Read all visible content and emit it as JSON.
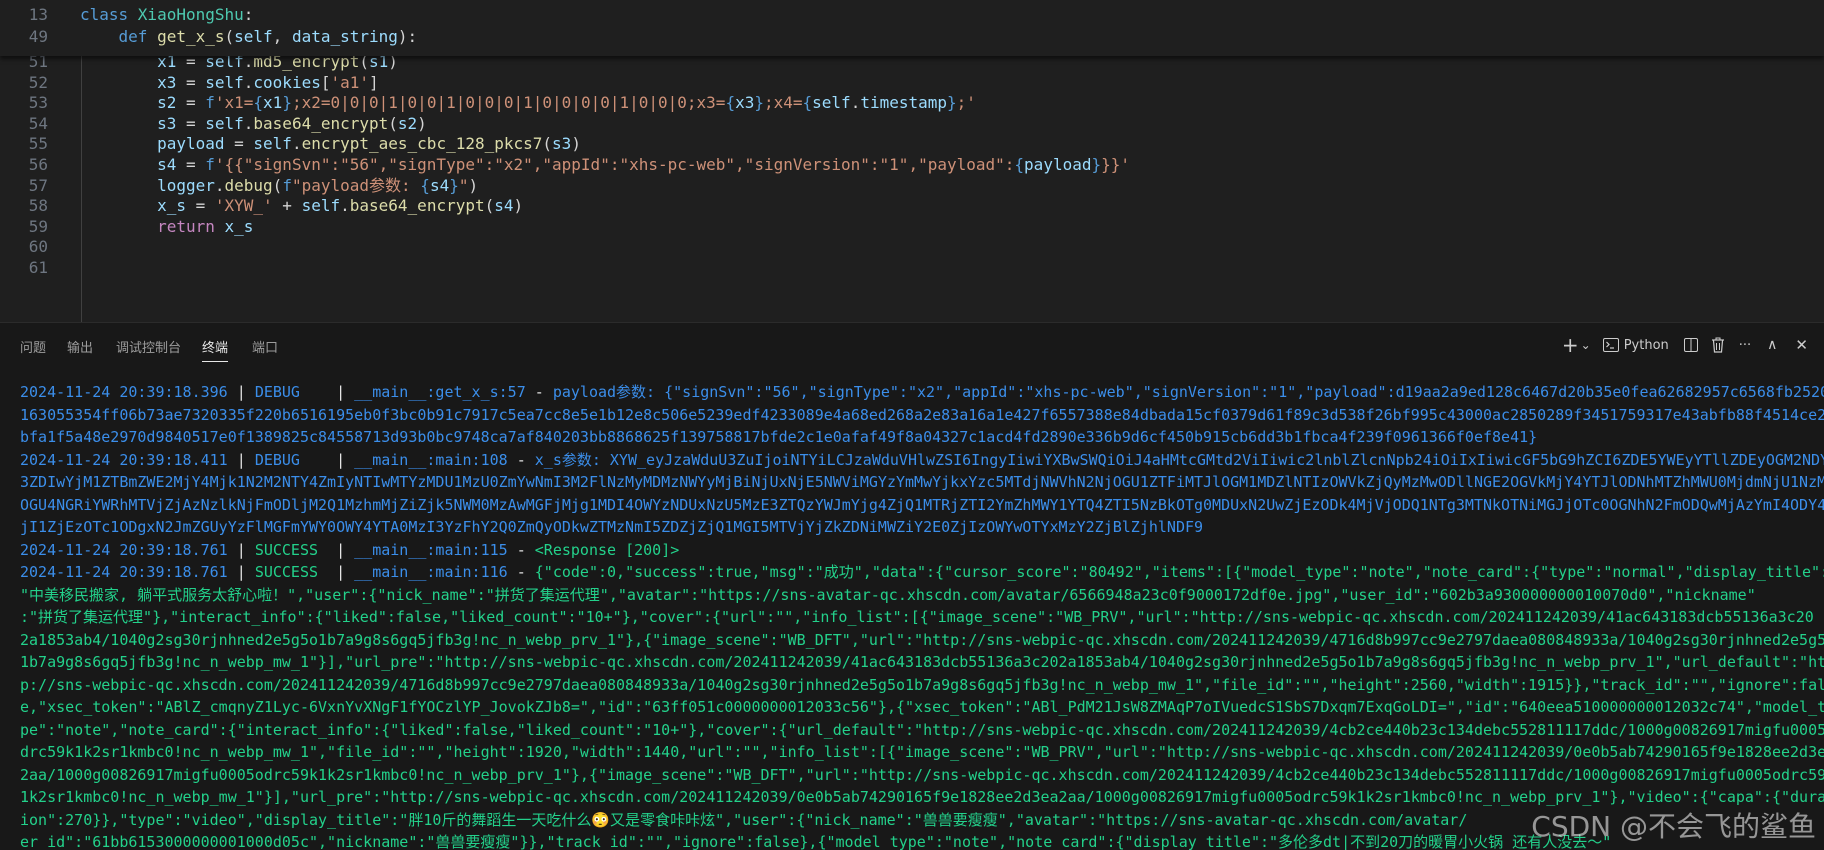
{
  "editor": {
    "sticky": [
      {
        "num": "13",
        "parts": [
          [
            "kw",
            "class "
          ],
          [
            "cls",
            "XiaoHongShu"
          ],
          [
            "tx",
            ":"
          ]
        ]
      },
      {
        "num": "49",
        "parts": [
          [
            "tx",
            "    "
          ],
          [
            "kw",
            "def "
          ],
          [
            "fn",
            "get_x_s"
          ],
          [
            "tx",
            "("
          ],
          [
            "var",
            "self"
          ],
          [
            "tx",
            ", "
          ],
          [
            "var",
            "data_string"
          ],
          [
            "tx",
            "):"
          ]
        ]
      }
    ],
    "lines": [
      {
        "num": "51",
        "parts": [
          [
            "tx",
            "        "
          ],
          [
            "var",
            "x1"
          ],
          [
            "tx",
            " = "
          ],
          [
            "var",
            "self"
          ],
          [
            "tx",
            "."
          ],
          [
            "fn",
            "md5_encrypt"
          ],
          [
            "tx",
            "("
          ],
          [
            "var",
            "s1"
          ],
          [
            "tx",
            ")"
          ]
        ]
      },
      {
        "num": "52",
        "parts": [
          [
            "tx",
            "        "
          ],
          [
            "var",
            "x3"
          ],
          [
            "tx",
            " = "
          ],
          [
            "var",
            "self"
          ],
          [
            "tx",
            "."
          ],
          [
            "var",
            "cookies"
          ],
          [
            "tx",
            "["
          ],
          [
            "str",
            "'a1'"
          ],
          [
            "tx",
            "]"
          ]
        ]
      },
      {
        "num": "53",
        "parts": [
          [
            "tx",
            "        "
          ],
          [
            "var",
            "s2"
          ],
          [
            "tx",
            " = "
          ],
          [
            "kw",
            "f"
          ],
          [
            "str",
            "'x1="
          ],
          [
            "brc",
            "{"
          ],
          [
            "var",
            "x1"
          ],
          [
            "brc",
            "}"
          ],
          [
            "str",
            ";x2=0|0|0|1|0|0|1|0|0|0|1|0|0|0|0|1|0|0|0;x3="
          ],
          [
            "brc",
            "{"
          ],
          [
            "var",
            "x3"
          ],
          [
            "brc",
            "}"
          ],
          [
            "str",
            ";x4="
          ],
          [
            "brc",
            "{"
          ],
          [
            "var",
            "self"
          ],
          [
            "tx",
            "."
          ],
          [
            "var",
            "timestamp"
          ],
          [
            "brc",
            "}"
          ],
          [
            "str",
            ";'"
          ]
        ]
      },
      {
        "num": "54",
        "parts": [
          [
            "tx",
            "        "
          ],
          [
            "var",
            "s3"
          ],
          [
            "tx",
            " = "
          ],
          [
            "var",
            "self"
          ],
          [
            "tx",
            "."
          ],
          [
            "fn",
            "base64_encrypt"
          ],
          [
            "tx",
            "("
          ],
          [
            "var",
            "s2"
          ],
          [
            "tx",
            ")"
          ]
        ]
      },
      {
        "num": "55",
        "parts": [
          [
            "tx",
            "        "
          ],
          [
            "var",
            "payload"
          ],
          [
            "tx",
            " = "
          ],
          [
            "var",
            "self"
          ],
          [
            "tx",
            "."
          ],
          [
            "fn",
            "encrypt_aes_cbc_128_pkcs7"
          ],
          [
            "tx",
            "("
          ],
          [
            "var",
            "s3"
          ],
          [
            "tx",
            ")"
          ]
        ]
      },
      {
        "num": "56",
        "parts": [
          [
            "tx",
            "        "
          ],
          [
            "var",
            "s4"
          ],
          [
            "tx",
            " = "
          ],
          [
            "kw",
            "f"
          ],
          [
            "str",
            "'{{\"signSvn\":\"56\",\"signType\":\"x2\",\"appId\":\"xhs-pc-web\",\"signVersion\":\"1\",\"payload\":"
          ],
          [
            "brc",
            "{"
          ],
          [
            "var",
            "payload"
          ],
          [
            "brc",
            "}"
          ],
          [
            "str",
            "}}'"
          ]
        ]
      },
      {
        "num": "57",
        "parts": [
          [
            "tx",
            "        "
          ],
          [
            "var",
            "logger"
          ],
          [
            "tx",
            "."
          ],
          [
            "fn",
            "debug"
          ],
          [
            "tx",
            "("
          ],
          [
            "kw",
            "f"
          ],
          [
            "str",
            "\"payload参数: "
          ],
          [
            "brc",
            "{"
          ],
          [
            "var",
            "s4"
          ],
          [
            "brc",
            "}"
          ],
          [
            "str",
            "\""
          ],
          [
            "tx",
            ")"
          ]
        ]
      },
      {
        "num": "58",
        "parts": [
          [
            "tx",
            "        "
          ],
          [
            "var",
            "x_s"
          ],
          [
            "tx",
            " = "
          ],
          [
            "str",
            "'XYW_'"
          ],
          [
            "tx",
            " + "
          ],
          [
            "var",
            "self"
          ],
          [
            "tx",
            "."
          ],
          [
            "fn",
            "base64_encrypt"
          ],
          [
            "tx",
            "("
          ],
          [
            "var",
            "s4"
          ],
          [
            "tx",
            ")"
          ]
        ]
      },
      {
        "num": "59",
        "parts": [
          [
            "tx",
            "        "
          ],
          [
            "ctl",
            "return "
          ],
          [
            "var",
            "x_s"
          ]
        ]
      },
      {
        "num": "60",
        "parts": []
      },
      {
        "num": "61",
        "parts": []
      }
    ]
  },
  "panel": {
    "tabs": [
      "问题",
      "输出",
      "调试控制台",
      "终端",
      "端口"
    ],
    "active_tab": "终端",
    "tools": {
      "add": "+",
      "dropdown": "⌄",
      "shell_label": "Python",
      "more": "···",
      "maximize": "∧",
      "close": "✕"
    }
  },
  "terminal": {
    "lines": [
      {
        "kind": "log",
        "ts": "2024-11-24 20:39:18.396",
        "level": "DEBUG   ",
        "mod": "__main__:get_x_s:57",
        "msg": "payload参数: {\"signSvn\":\"56\",\"signType\":\"x2\",\"appId\":\"xhs-pc-web\",\"signVersion\":\"1\",\"payload\":d19aa2a9ed128c6467d20b35e0fea62682957c6568fb2520"
      },
      {
        "kind": "cont",
        "cls": "dbg-msg",
        "text": "163055354ff06b73ae7320335f220b6516195eb0f3bc0b91c7917c5ea7cc8e5e1b12e8c506e5239edf4233089e4a68ed268a2e83a16a1e427f6557388e84dbada15cf0379d61f89c3d538f26bf995c43000ac2850289f3451759317e43abfb88f4514ce20"
      },
      {
        "kind": "cont",
        "cls": "dbg-msg",
        "text": "bfa1f5a48e2970d9840517e0f1389825c84558713d93b0bc9748ca7af840203bb8868625f139758817bfde2c1e0afaf49f8a04327c1acd4fd2890e336b9d6cf450b915cb6dd3b1fbca4f239f0961366f0ef8e41}"
      },
      {
        "kind": "log",
        "ts": "2024-11-24 20:39:18.411",
        "level": "DEBUG   ",
        "mod": "__main__:main:108",
        "msg": "x_s参数: XYW_eyJzaWduU3ZuIjoiNTYiLCJzaWduVHlwZSI6IngyIiwiYXBwSWQiOiJ4aHMtcGMtd2ViIiwic2lnblZlcnNpb24iOiIxIiwicGF5bG9hZCI6ZDE5YWEyYTllZDEyOGM2NDY"
      },
      {
        "kind": "cont",
        "cls": "dbg-msg",
        "text": "3ZDIwYjM1ZTBmZWE2MjY4Mjk1N2M2NTY4ZmIyNTIwMTYzMDU1MzU0ZmYwNmI3M2FlNzMyMDMzNWYyMjBiNjUxNjE5NWViMGYzYmMwYjkxYzc5MTdjNWVhN2NjOGU1ZTFiMTJlOGM1MDZlNTIzOWVkZjQyMzMwODllNGE2OGVkMjY4YTJlODNhMTZhMWU0MjdmNjU1NzM4"
      },
      {
        "kind": "cont",
        "cls": "dbg-msg",
        "text": "OGU4NGRiYWRhMTVjZjAzNzlkNjFmODljM2Q1MzhmMjZiZjk5NWM0MzAwMGFjMjg1MDI4OWYzNDUxNzU5MzE3ZTQzYWJmYjg4ZjQ1MTRjZTI2YmZhMWY1YTQ4ZTI5NzBkOTg0MDUxN2UwZjEzODk4MjVjODQ1NTg3MTNkOTNiMGJjOTc0OGNhN2FmODQwMjAzYmI4ODY4"
      },
      {
        "kind": "cont",
        "cls": "dbg-msg",
        "text": "jI1ZjEzOTc1ODgxN2JmZGUyYzFlMGFmYWY0OWY4YTA0MzI3YzFhY2Q0ZmQyODkwZTMzNmI5ZDZjZjQ1MGI5MTVjYjZkZDNiMWZiY2E0ZjIzOWYwOTYxMzY2ZjBlZjhlNDF9"
      },
      {
        "kind": "log",
        "ts": "2024-11-24 20:39:18.761",
        "level": "SUCCESS ",
        "mod": "__main__:main:115",
        "msg": "<Response [200]>"
      },
      {
        "kind": "log",
        "ts": "2024-11-24 20:39:18.761",
        "level": "SUCCESS ",
        "mod": "__main__:main:116",
        "msg": "{\"code\":0,\"success\":true,\"msg\":\"成功\",\"data\":{\"cursor_score\":\"80492\",\"items\":[{\"model_type\":\"note\",\"note_card\":{\"type\":\"normal\",\"display_title\":"
      },
      {
        "kind": "cont",
        "cls": "suc-msg",
        "text": "\"中美移民搬家, 躺平式服务太舒心啦！\",\"user\":{\"nick_name\":\"拼货了集运代理\",\"avatar\":\"https://sns-avatar-qc.xhscdn.com/avatar/6566948a23c0f9000172df0e.jpg\",\"user_id\":\"602b3a930000000010070d0\",\"nickname\""
      },
      {
        "kind": "cont",
        "cls": "suc-msg",
        "text": ":\"拼货了集运代理\"},\"interact_info\":{\"liked\":false,\"liked_count\":\"10+\"},\"cover\":{\"url\":\"\",\"info_list\":[{\"image_scene\":\"WB_PRV\",\"url\":\"http://sns-webpic-qc.xhscdn.com/202411242039/41ac643183dcb55136a3c20"
      },
      {
        "kind": "cont",
        "cls": "suc-msg",
        "text": "2a1853ab4/1040g2sg30rjnhned2e5g5o1b7a9g8s6gq5jfb3g!nc_n_webp_prv_1\"},{\"image_scene\":\"WB_DFT\",\"url\":\"http://sns-webpic-qc.xhscdn.com/202411242039/4716d8b997cc9e2797daea080848933a/1040g2sg30rjnhned2e5g5o"
      },
      {
        "kind": "cont",
        "cls": "suc-msg",
        "text": "1b7a9g8s6gq5jfb3g!nc_n_webp_mw_1\"}],\"url_pre\":\"http://sns-webpic-qc.xhscdn.com/202411242039/41ac643183dcb55136a3c202a1853ab4/1040g2sg30rjnhned2e5g5o1b7a9g8s6gq5jfb3g!nc_n_webp_prv_1\",\"url_default\":\"htt"
      },
      {
        "kind": "cont",
        "cls": "suc-msg",
        "text": "p://sns-webpic-qc.xhscdn.com/202411242039/4716d8b997cc9e2797daea080848933a/1040g2sg30rjnhned2e5g5o1b7a9g8s6gq5jfb3g!nc_n_webp_mw_1\",\"file_id\":\"\",\"height\":2560,\"width\":1915}},\"track_id\":\"\",\"ignore\":fals"
      },
      {
        "kind": "cont",
        "cls": "suc-msg",
        "text": "e,\"xsec_token\":\"ABlZ_cmqnyZ1Lyc-6VxnYvXNgF1fYOCzlYP_JovokZJb8=\",\"id\":\"63ff051c0000000012033c56\"},{\"xsec_token\":\"ABl_PdM21JsW8ZMAqP7oIVuedcS1SbS7Dxqm7ExqGoLDI=\",\"id\":\"640eea510000000012032c74\",\"model_ty"
      },
      {
        "kind": "cont",
        "cls": "suc-msg",
        "text": "pe\":\"note\",\"note_card\":{\"interact_info\":{\"liked\":false,\"liked_count\":\"10+\"},\"cover\":{\"url_default\":\"http://sns-webpic-qc.xhscdn.com/202411242039/4cb2ce440b23c134debc552811117ddc/1000g00826917migfu0005o"
      },
      {
        "kind": "cont",
        "cls": "suc-msg",
        "text": "drc59k1k2sr1kmbc0!nc_n_webp_mw_1\",\"file_id\":\"\",\"height\":1920,\"width\":1440,\"url\":\"\",\"info_list\":[{\"image_scene\":\"WB_PRV\",\"url\":\"http://sns-webpic-qc.xhscdn.com/202411242039/0e0b5ab74290165f9e1828ee2d3ea"
      },
      {
        "kind": "cont",
        "cls": "suc-msg",
        "text": "2aa/1000g00826917migfu0005odrc59k1k2sr1kmbc0!nc_n_webp_prv_1\"},{\"image_scene\":\"WB_DFT\",\"url\":\"http://sns-webpic-qc.xhscdn.com/202411242039/4cb2ce440b23c134debc552811117ddc/1000g00826917migfu0005odrc59k"
      },
      {
        "kind": "cont",
        "cls": "suc-msg",
        "text": "1k2sr1kmbc0!nc_n_webp_mw_1\"}],\"url_pre\":\"http://sns-webpic-qc.xhscdn.com/202411242039/0e0b5ab74290165f9e1828ee2d3ea2aa/1000g00826917migfu0005odrc59k1k2sr1kmbc0!nc_n_webp_prv_1\"},\"video\":{\"capa\":{\"durat"
      },
      {
        "kind": "cont",
        "cls": "suc-msg",
        "text": "ion\":270}},\"type\":\"video\",\"display_title\":\"胖10斤的舞蹈生一天吃什么😳又是零食咔咔炫\",\"user\":{\"nick_name\":\"兽兽要瘦瘦\",\"avatar\":\"https://sns-avatar-qc.xhscdn.com/avatar/"
      },
      {
        "kind": "cont",
        "cls": "suc-msg",
        "text": "er_id\":\"61bb6153000000001000d05c\",\"nickname\":\"兽兽要瘦瘦\"}},\"track_id\":\"\",\"ignore\":false},{\"model_type\":\"note\",\"note_card\":{\"display_title\":\"多伦多dt|不到20刀的暖胃小火锅 还有人没去～\""
      }
    ]
  },
  "watermark": "CSDN @不会飞的鲨鱼"
}
